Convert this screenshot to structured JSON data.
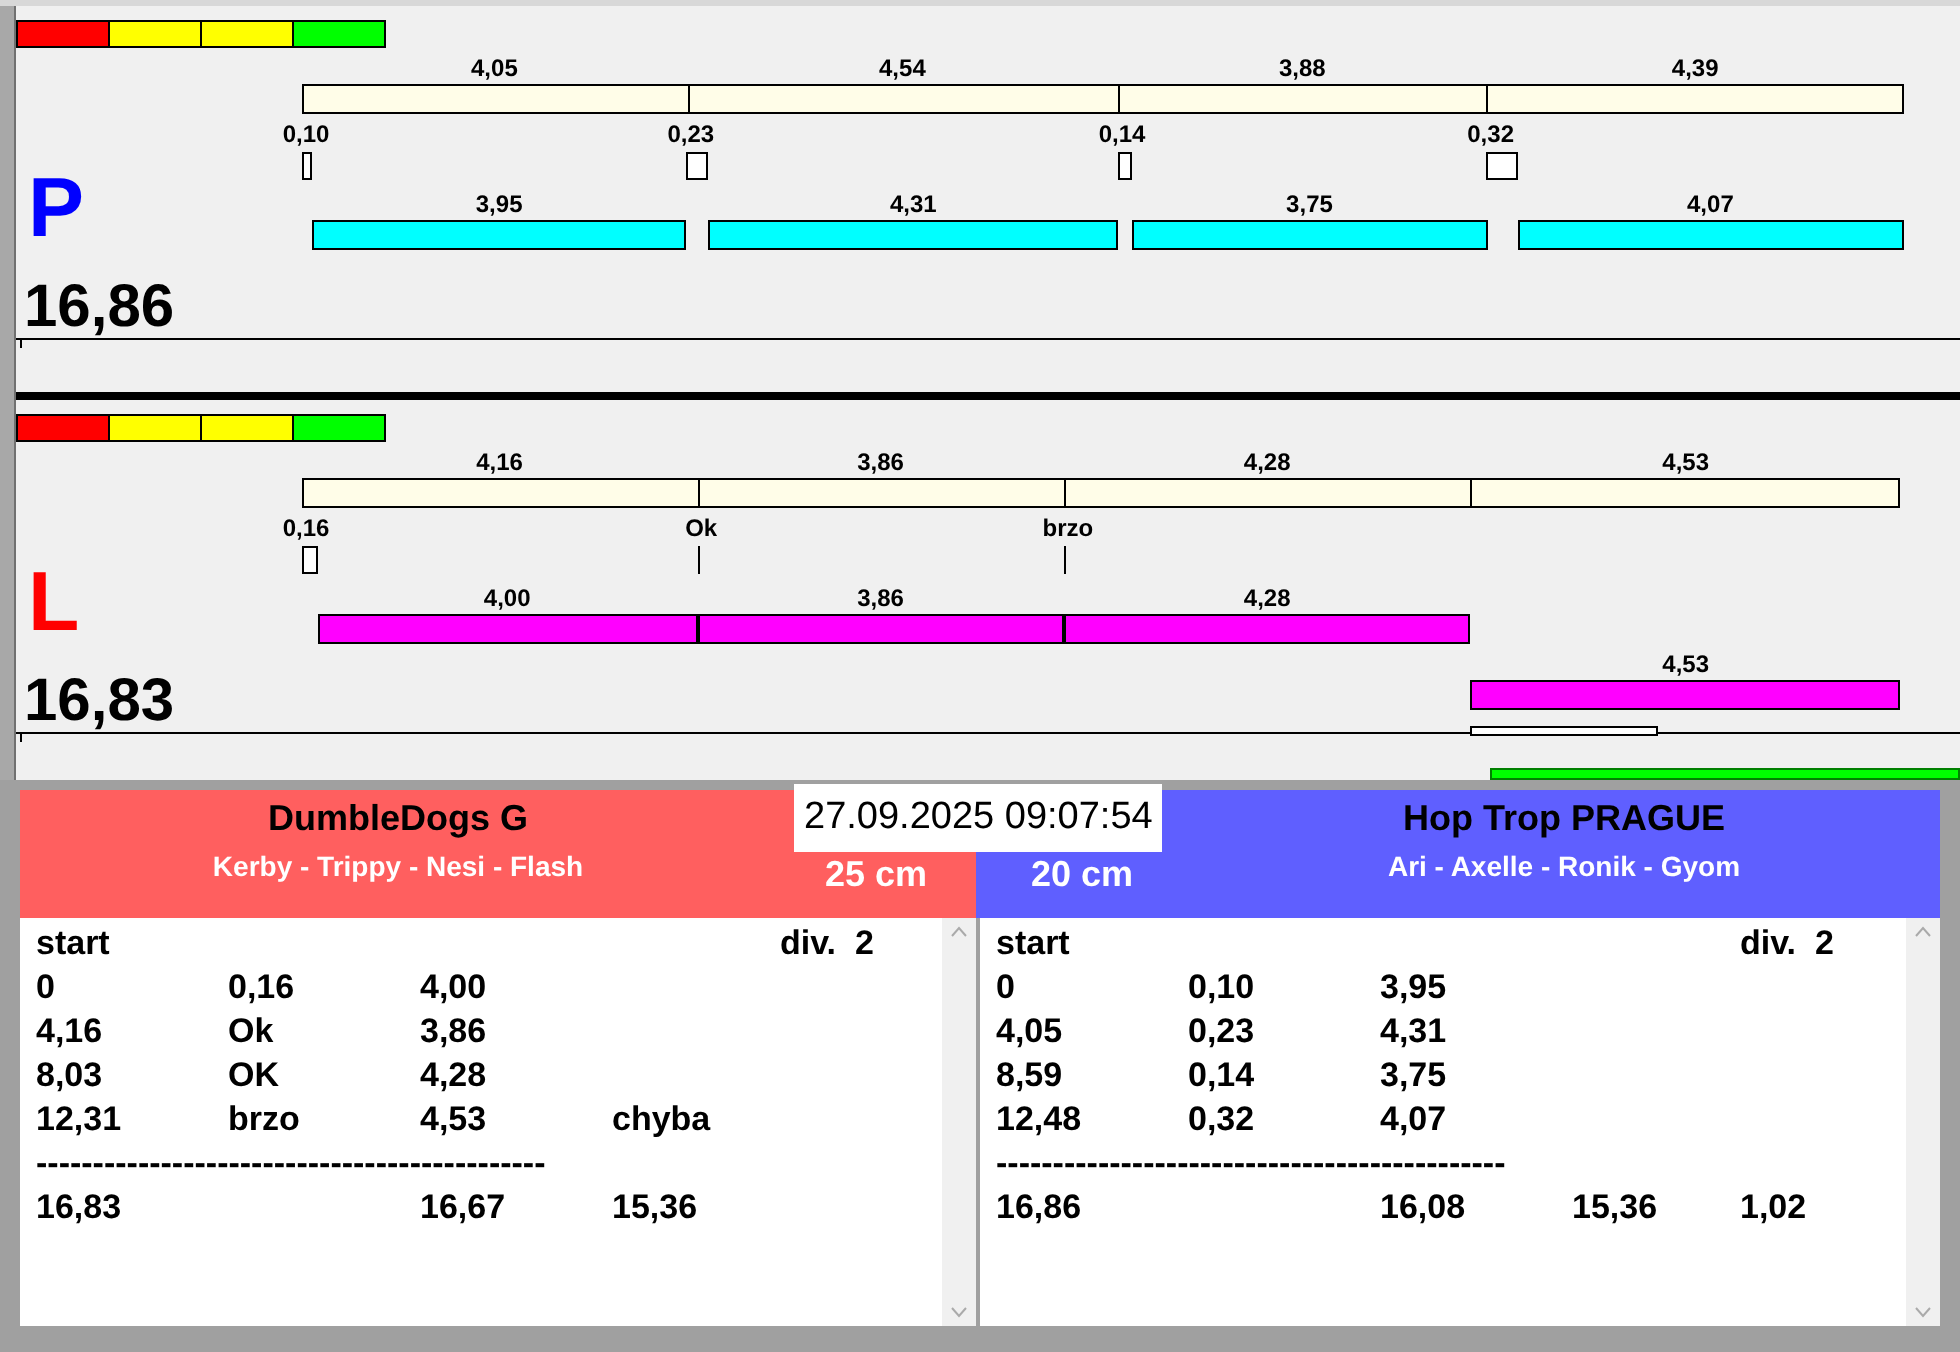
{
  "lanes": [
    {
      "letter": "P",
      "color": "#0000ff",
      "total": "16,86",
      "indicator": [
        {
          "color": "#ff0000"
        },
        {
          "color": "#ffff00"
        },
        {
          "color": "#ffff00"
        },
        {
          "color": "#00ff00"
        }
      ],
      "reference": [
        {
          "label": "4,05"
        },
        {
          "label": "4,54"
        },
        {
          "label": "3,88"
        },
        {
          "label": "4,39"
        }
      ],
      "reactions": [
        {
          "label": "0,10",
          "kind": "gap"
        },
        {
          "label": "0,23",
          "kind": "gap"
        },
        {
          "label": "0,14",
          "kind": "gap"
        },
        {
          "label": "0,32",
          "kind": "gap"
        }
      ],
      "runs": [
        {
          "label": "3,95",
          "color": "#00ffff"
        },
        {
          "label": "4,31",
          "color": "#00ffff"
        },
        {
          "label": "3,75",
          "color": "#00ffff"
        },
        {
          "label": "4,07",
          "color": "#00ffff"
        }
      ]
    },
    {
      "letter": "L",
      "color": "#ff0000",
      "total": "16,83",
      "indicator": [
        {
          "color": "#ff0000"
        },
        {
          "color": "#ffff00"
        },
        {
          "color": "#ffff00"
        },
        {
          "color": "#00ff00"
        }
      ],
      "reference": [
        {
          "label": "4,16"
        },
        {
          "label": "3,86"
        },
        {
          "label": "4,28"
        },
        {
          "label": "4,53"
        }
      ],
      "reactions": [
        {
          "label": "0,16",
          "kind": "gap"
        },
        {
          "label": "Ok",
          "kind": "tick"
        },
        {
          "label": "brzo",
          "kind": "tick"
        }
      ],
      "runs": [
        {
          "label": "4,00",
          "color": "#ff00ff"
        },
        {
          "label": "3,86",
          "color": "#ff00ff"
        },
        {
          "label": "4,28",
          "color": "#ff00ff"
        },
        {
          "label": "4,53",
          "color": "#ff00ff"
        }
      ]
    }
  ],
  "date_time": "27.09.2025 09:07:54",
  "teams": [
    {
      "name": "DumbleDogs G",
      "members": "Kerby - Trippy - Nesi - Flash",
      "height": "25 cm",
      "color": "#ff5f5f",
      "header": "start",
      "division": "div.  2",
      "rows": [
        [
          "0",
          "0,16",
          "4,00"
        ],
        [
          "4,16",
          "Ok",
          "3,86"
        ],
        [
          "8,03",
          "OK",
          "4,28"
        ],
        [
          "12,31",
          "brzo",
          "4,53",
          "chyba"
        ]
      ],
      "separator": "---------------------------------------------",
      "totals": {
        "column_1": "16,83",
        "column_3": "16,67",
        "column_4": "15,36"
      }
    },
    {
      "name": "Hop Trop PRAGUE",
      "members": "Ari - Axelle - Ronik - Gyom",
      "height": "20 cm",
      "color": "#5f5fff",
      "header": "start",
      "division": "div.  2",
      "rows": [
        [
          "0",
          "0,10",
          "3,95"
        ],
        [
          "4,05",
          "0,23",
          "4,31"
        ],
        [
          "8,59",
          "0,14",
          "3,75"
        ],
        [
          "12,48",
          "0,32",
          "4,07"
        ]
      ],
      "separator": "---------------------------------------------",
      "totals": {
        "column_1": "16,86",
        "column_3": "16,08",
        "column_4": "15,36",
        "column_5": "1,02"
      }
    }
  ]
}
